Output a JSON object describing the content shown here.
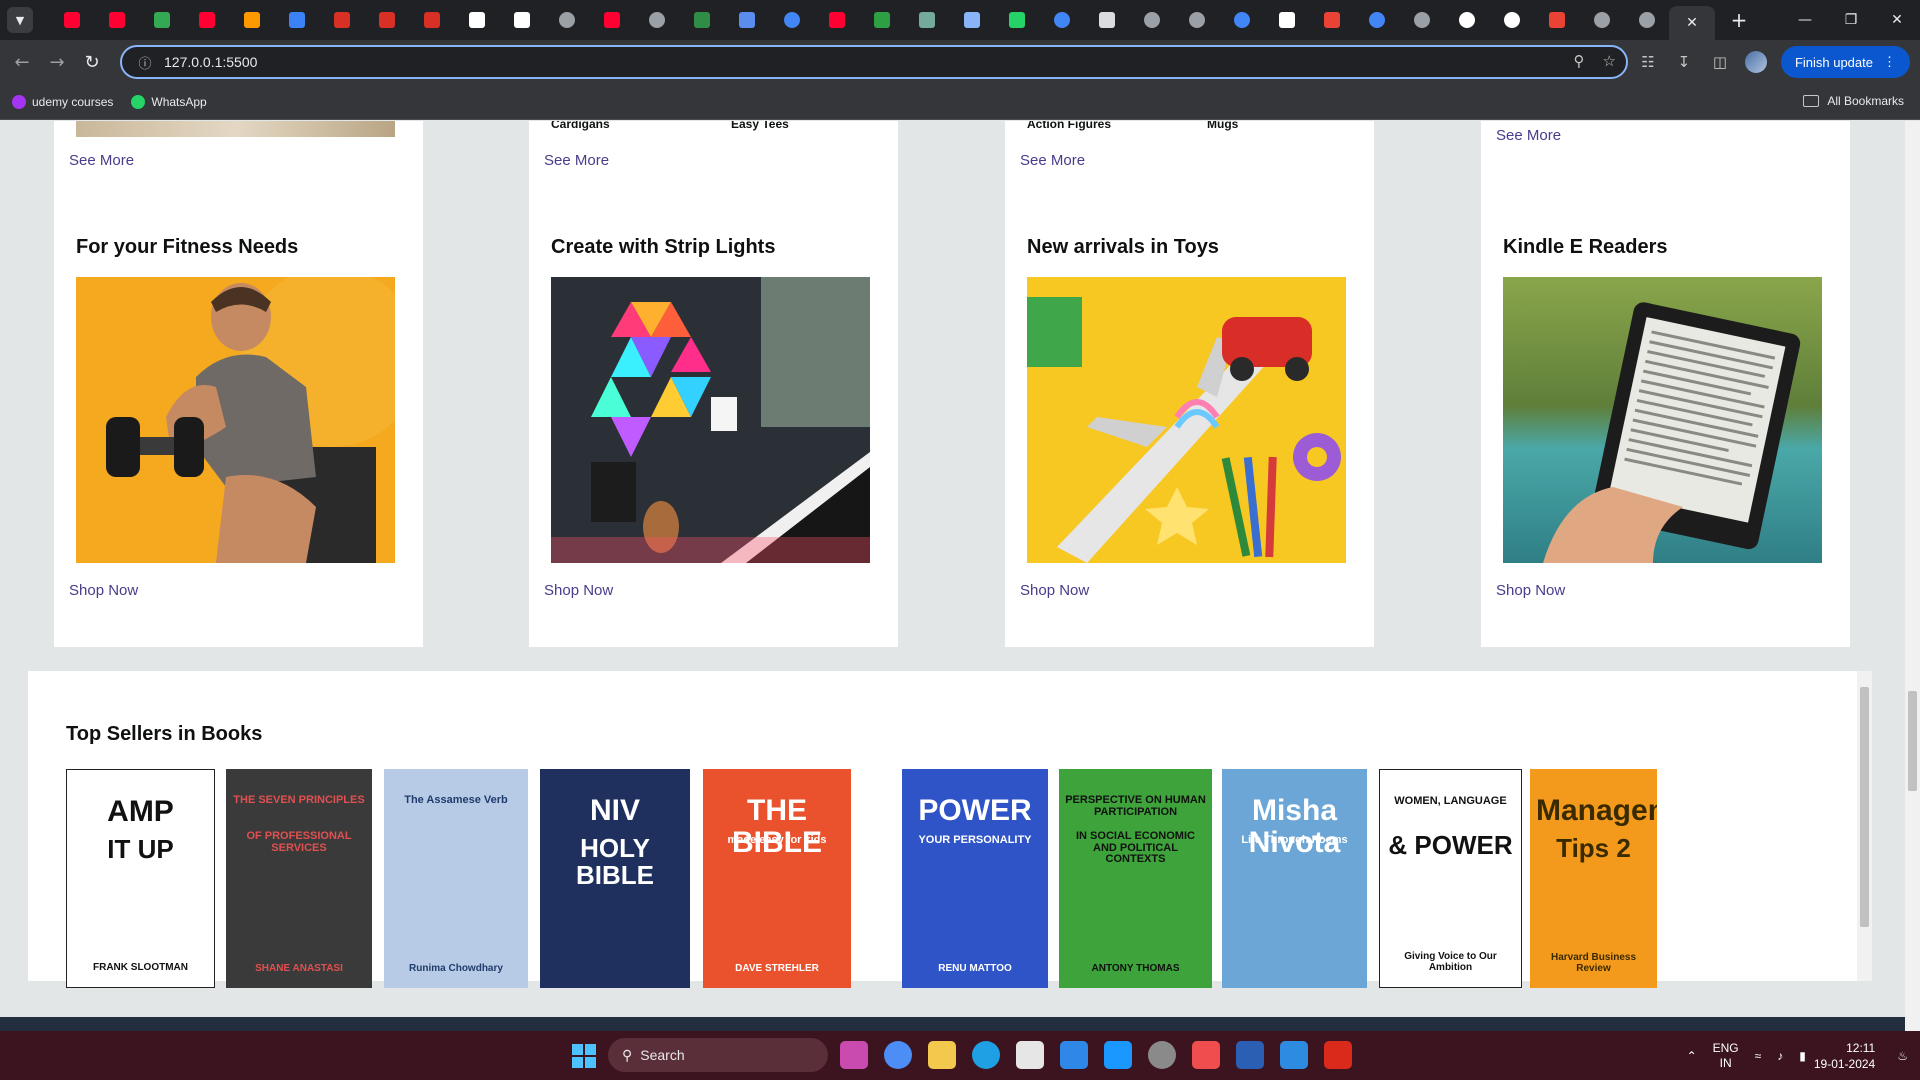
{
  "browser": {
    "url": "127.0.0.1:5500",
    "finish_update": "Finish update",
    "bookmarks": [
      {
        "label": "udemy courses",
        "color": "#a435f0"
      },
      {
        "label": "WhatsApp",
        "color": "#25d366"
      }
    ],
    "all_bookmarks": "All Bookmarks",
    "tab_icons": [
      "youtube-icon",
      "youtube-icon",
      "drive-icon",
      "youtube-icon",
      "amazon-icon",
      "power-icon",
      "pdf-icon",
      "pdf-icon",
      "pdf-icon",
      "notification-icon",
      "notion-icon",
      "globe-icon",
      "youtube-icon",
      "globe-icon",
      "gfg-icon",
      "figma-icon",
      "google-icon",
      "youtube-icon",
      "code-icon",
      "chatgpt-icon",
      "gemini-icon",
      "whatsapp-icon",
      "google-icon",
      "tab-icon",
      "globe-icon",
      "globe-icon",
      "google-icon",
      "security-icon",
      "record-icon",
      "google-icon",
      "globe-icon",
      "github-icon",
      "github-icon",
      "gmail-icon",
      "globe-icon",
      "globe-icon"
    ]
  },
  "top_row": {
    "cards": [
      {
        "labels": [],
        "link": "See More"
      },
      {
        "labels": [
          "Cardigans",
          "Easy Tees"
        ],
        "link": "See More"
      },
      {
        "labels": [
          "Action Figures",
          "Mugs"
        ],
        "link": "See More"
      },
      {
        "labels": [],
        "link": "See More"
      }
    ]
  },
  "cards": [
    {
      "title": "For your Fitness Needs",
      "image": "fitness-photo",
      "link": "Shop Now"
    },
    {
      "title": "Create with Strip Lights",
      "image": "strip-lights-photo",
      "link": "Shop Now"
    },
    {
      "title": "New arrivals in Toys",
      "image": "toys-photo",
      "link": "Shop Now"
    },
    {
      "title": "Kindle E Readers",
      "image": "kindle-photo",
      "link": "Shop Now"
    }
  ],
  "books": {
    "title": "Top Sellers in Books",
    "items": [
      {
        "name": "amp-it-up",
        "line1": "AMP",
        "line2": "IT UP",
        "author": "FRANK SLOOTMAN",
        "bg": "#ffffff",
        "fg": "#111111"
      },
      {
        "name": "seven-principles",
        "line1": "THE SEVEN PRINCIPLES",
        "line2": "OF PROFESSIONAL SERVICES",
        "author": "SHANE ANASTASI",
        "bg": "#3a3a3a",
        "fg": "#e05050"
      },
      {
        "name": "assamese-verb",
        "line1": "The Assamese Verb",
        "line2": "",
        "author": "Runima Chowdhary",
        "bg": "#b8cbe6",
        "fg": "#1f3c6b"
      },
      {
        "name": "niv-holy-bible",
        "line1": "NIV",
        "line2": "HOLY BIBLE",
        "author": "",
        "bg": "#1f2f5e",
        "fg": "#ffffff"
      },
      {
        "name": "bible-made-easy",
        "line1": "THE BIBLE",
        "line2": "made easy for kids",
        "author": "DAVE STREHLER",
        "bg": "#e9522d",
        "fg": "#ffffff"
      },
      {
        "name": "power-your-personality",
        "line1": "POWER",
        "line2": "YOUR PERSONALITY",
        "author": "RENU MATTOO",
        "bg": "#2e54c8",
        "fg": "#ffffff"
      },
      {
        "name": "perspective-human",
        "line1": "PERSPECTIVE ON HUMAN PARTICIPATION",
        "line2": "IN SOCIAL ECONOMIC AND POLITICAL CONTEXTS",
        "author": "ANTONY THOMAS",
        "bg": "#3da33a",
        "fg": "#111111"
      },
      {
        "name": "life-through-poems",
        "line1": "Misha Nivota",
        "line2": "Life Through Poems",
        "author": "",
        "bg": "#6ca6d6",
        "fg": "#ffffff"
      },
      {
        "name": "women-language-power",
        "line1": "WOMEN, LANGUAGE",
        "line2": "& POWER",
        "author": "Giving Voice to Our Ambition",
        "bg": "#ffffff",
        "fg": "#111111"
      },
      {
        "name": "management-tips",
        "line1": "Management",
        "line2": "Tips 2",
        "author": "Harvard Business Review",
        "bg": "#f39a1c",
        "fg": "#3a2a00"
      }
    ]
  },
  "taskbar": {
    "search": "Search",
    "lang1": "ENG",
    "lang2": "IN",
    "time": "12:11",
    "date": "19-01-2024"
  }
}
